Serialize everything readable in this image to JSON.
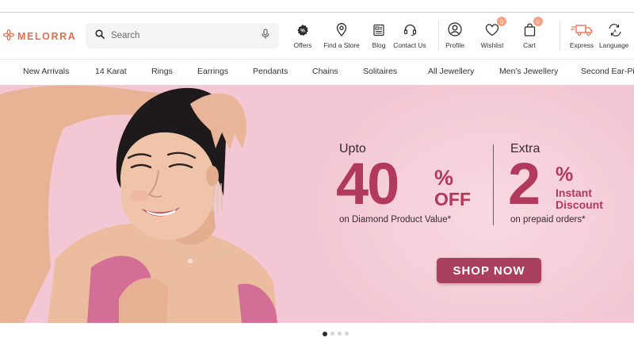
{
  "brand": {
    "name": "MELORRA",
    "accent": "#e46d4a"
  },
  "search": {
    "placeholder": "Search"
  },
  "header_items": {
    "offers": "Offers",
    "find_store": "Find a Store",
    "blog": "Blog",
    "contact": "Contact Us",
    "profile": "Profile",
    "wishlist": "Wishlist",
    "wishlist_count": "0",
    "cart": "Cart",
    "cart_count": "0",
    "express": "Express",
    "language": "Language"
  },
  "nav": [
    "New Arrivals",
    "14 Karat",
    "Rings",
    "Earrings",
    "Pendants",
    "Chains",
    "Solitaires",
    "All Jewellery",
    "Men's Jewellery",
    "Second Ear-Piercing"
  ],
  "banner": {
    "offer1": {
      "prefix": "Upto",
      "value": "40",
      "percent": "%",
      "suffix": "OFF",
      "sub": "on Diamond Product Value*"
    },
    "offer2": {
      "prefix": "Extra",
      "value": "2",
      "percent": "%",
      "line1": "Instant",
      "line2": "Discount",
      "sub": "on prepaid orders*"
    },
    "cta": "SHOP NOW",
    "colors": {
      "background": "#f3c7d3",
      "accent": "#b2395e",
      "button": "#a8405e"
    }
  },
  "carousel": {
    "slides": 4,
    "active": 1
  },
  "icons": [
    "flower-logo-icon",
    "search-icon",
    "mic-icon",
    "offers-percent-icon",
    "map-pin-icon",
    "blog-icon",
    "headset-icon",
    "user-icon",
    "heart-icon",
    "cart-bag-icon",
    "truck-icon",
    "language-icon"
  ]
}
